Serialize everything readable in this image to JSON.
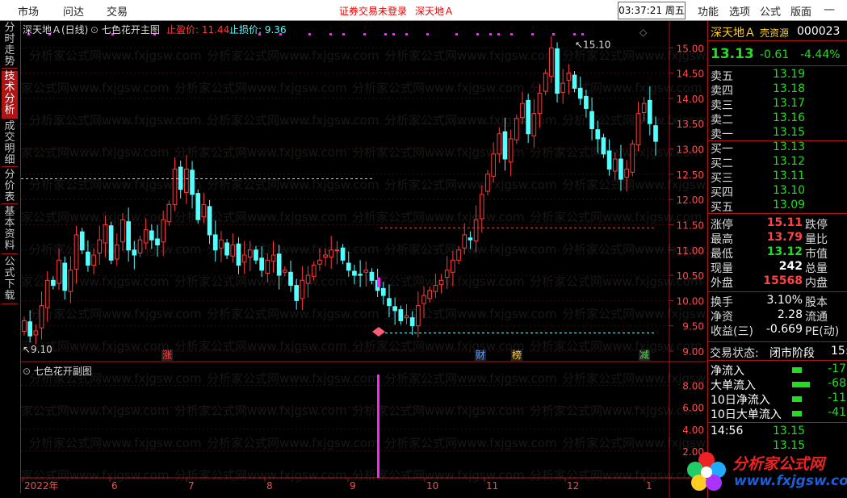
{
  "menubar": {
    "items": [
      "市场",
      "问达",
      "交易"
    ],
    "notice": "证券交易未登录",
    "stock": "深天地Ａ",
    "time": "03:37:21 周五",
    "right_items": [
      "功能",
      "选项",
      "公式",
      "版面"
    ],
    "minimize_icon": "minimize-icon",
    "close_icon": "close-icon"
  },
  "left_tabs": [
    "分时走势",
    "技术分析",
    "成交明细",
    "分价表",
    "基本资料",
    "公式下载"
  ],
  "main_header": {
    "title": "深天地Ａ(日线)",
    "indicator": "七色花开主图",
    "stop_profit_label": "止盈价: 11.44",
    "stop_loss_label": "止损价: 9.36"
  },
  "sub_header": {
    "indicator": "七色花开副图"
  },
  "watermark": {
    "line": "分析家公式网www.fxjgsw.com"
  },
  "colors": {
    "up": "#ff3a3a",
    "down": "#54ffff",
    "accent": "#b01515",
    "magenta": "#ff22ff",
    "green": "#22dd22",
    "yellow": "#ffcc33"
  },
  "chart_data": {
    "type": "candlestick",
    "price_axis": [
      "15.00",
      "14.50",
      "14.00",
      "13.50",
      "13.00",
      "12.50",
      "12.00",
      "11.50",
      "11.00",
      "10.50",
      "10.00",
      "9.50",
      "9.00"
    ],
    "ylim": [
      9.0,
      15.1
    ],
    "high_marker": "15.10",
    "low_marker": "9.10",
    "stop_profit": 11.44,
    "stop_loss": 9.36,
    "support_line": 12.41,
    "event_labels": [
      "涨",
      "财",
      "榜",
      "减"
    ],
    "x_labels": [
      "2022年",
      "6",
      "7",
      "8",
      "9",
      "10",
      "11",
      "12",
      "1"
    ],
    "sub_axis": [
      "8.00",
      "6.00",
      "4.00",
      "2.00"
    ],
    "sub_ylim": [
      0,
      9
    ],
    "sub_bar_value": 9.0,
    "closes": [
      9.6,
      9.3,
      9.4,
      9.9,
      10.4,
      10.3,
      10.8,
      10.2,
      10.6,
      11.3,
      11.0,
      10.7,
      10.9,
      11.2,
      11.5,
      10.8,
      11.1,
      11.6,
      11.0,
      10.9,
      11.2,
      11.4,
      11.2,
      11.1,
      11.6,
      11.9,
      12.6,
      12.2,
      12.6,
      12.1,
      11.6,
      11.9,
      11.3,
      11.0,
      11.2,
      10.9,
      11.1,
      10.7,
      10.9,
      11.0,
      10.8,
      10.6,
      10.8,
      10.9,
      10.5,
      10.6,
      10.3,
      10.0,
      10.4,
      10.5,
      10.7,
      10.8,
      10.9,
      11.0,
      11.0,
      10.8,
      10.6,
      10.5,
      10.5,
      10.6,
      10.4,
      10.2,
      10.1,
      9.9,
      9.8,
      9.6,
      9.7,
      9.5,
      9.9,
      10.1,
      10.2,
      10.3,
      10.4,
      10.6,
      10.8,
      11.0,
      11.3,
      11.2,
      11.6,
      12.1,
      12.5,
      12.9,
      13.3,
      12.8,
      13.2,
      13.6,
      13.9,
      13.3,
      13.7,
      14.1,
      14.5,
      15.0,
      14.1,
      14.3,
      14.5,
      14.2,
      14.0,
      13.8,
      13.4,
      13.2,
      12.9,
      12.6,
      12.8,
      12.4,
      12.6,
      13.1,
      13.7,
      13.9,
      13.5,
      13.15
    ],
    "dots": [
      6,
      7,
      10,
      13,
      14,
      15,
      19,
      23,
      24,
      27,
      29,
      34,
      35,
      38,
      39,
      40,
      41,
      42,
      45,
      46,
      47,
      48,
      49
    ],
    "values": []
  },
  "quote": {
    "name": "深天地Ａ",
    "tag": "壳资源",
    "code": "000023",
    "price": "13.13",
    "change": "-0.61",
    "pct": "-4.44%",
    "asks": [
      {
        "label": "卖五",
        "price": "13.19"
      },
      {
        "label": "卖四",
        "price": "13.18"
      },
      {
        "label": "卖三",
        "price": "13.17"
      },
      {
        "label": "卖二",
        "price": "13.16"
      },
      {
        "label": "卖一",
        "price": "13.15"
      }
    ],
    "bids": [
      {
        "label": "买一",
        "price": "13.13"
      },
      {
        "label": "买二",
        "price": "13.12"
      },
      {
        "label": "买三",
        "price": "13.11"
      },
      {
        "label": "买四",
        "price": "13.10"
      },
      {
        "label": "买五",
        "price": "13.09"
      }
    ],
    "stats": [
      {
        "label": "涨停",
        "value": "15.11",
        "label2": "跌停"
      },
      {
        "label": "最高",
        "value": "13.79",
        "label2": "量比"
      },
      {
        "label": "最低",
        "value": "13.12",
        "label2": "市值"
      },
      {
        "label": "现量",
        "value": "242",
        "label2": "总量"
      },
      {
        "label": "外盘",
        "value": "15568",
        "label2": "内盘"
      }
    ],
    "stats2": [
      {
        "label": "换手",
        "value": "3.10%",
        "label2": "股本"
      },
      {
        "label": "净资",
        "value": "2.28",
        "label2": "流通"
      },
      {
        "label": "收益(三)",
        "value": "-0.669",
        "label2": "PE(动)"
      }
    ],
    "trade_status_label": "交易状态:",
    "trade_status": "闭市阶段",
    "trade_status_tail": "15:",
    "flows": [
      {
        "label": "净流入",
        "value": "-17"
      },
      {
        "label": "大单流入",
        "value": "-68"
      },
      {
        "label": "10日净流入",
        "value": "-11"
      },
      {
        "label": "10日大单流入",
        "value": "-41"
      }
    ],
    "ticks": [
      {
        "time": "14:56",
        "price": "13.15"
      },
      {
        "time": "",
        "price": "13.15"
      }
    ]
  },
  "logo": {
    "text": "分析家公式网",
    "url": "www.fxjgsw.com"
  }
}
